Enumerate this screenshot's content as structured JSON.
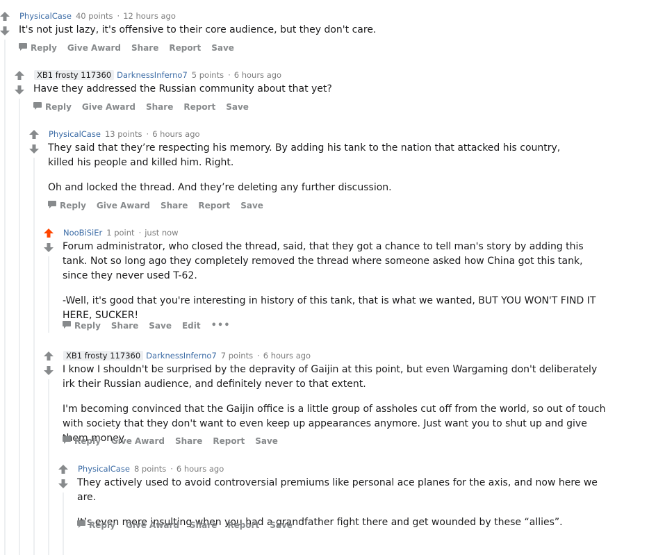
{
  "comments": [
    {
      "author": "PhysicalCase",
      "flair": "",
      "points": "40 points",
      "time": "12 hours ago",
      "upvoted": false,
      "paragraphs": [
        "It's not just lazy, it's offensive to their core audience, but they don't care."
      ],
      "actions": [
        "Reply",
        "Give Award",
        "Share",
        "Report",
        "Save"
      ]
    },
    {
      "author": "DarknessInferno7",
      "flair": "XB1 frosty 117360",
      "points": "5 points",
      "time": "6 hours ago",
      "upvoted": false,
      "paragraphs": [
        "Have they addressed the Russian community about that yet?"
      ],
      "actions": [
        "Reply",
        "Give Award",
        "Share",
        "Report",
        "Save"
      ]
    },
    {
      "author": "PhysicalCase",
      "flair": "",
      "points": "13 points",
      "time": "6 hours ago",
      "upvoted": false,
      "paragraphs": [
        "They said that they’re respecting his memory. By adding his tank to the nation that attacked his country, killed his people and killed him. Right.",
        "Oh and locked the thread. And they’re deleting any further discussion."
      ],
      "actions": [
        "Reply",
        "Give Award",
        "Share",
        "Report",
        "Save"
      ]
    },
    {
      "author": "NooBiSiEr",
      "flair": "",
      "points": "1 point",
      "time": "just now",
      "upvoted": true,
      "paragraphs": [
        "Forum administrator, who closed the thread, said, that they got a chance to tell man's story by adding this tank. Not so long ago they completely removed the thread where someone asked how China got this tank, since they never used T-62.",
        "-Well, it's good that you're interesting in history of this tank, that is what we wanted, BUT YOU WON'T FIND IT HERE, SUCKER!"
      ],
      "actions": [
        "Reply",
        "Share",
        "Save",
        "Edit",
        "•••"
      ]
    },
    {
      "author": "DarknessInferno7",
      "flair": "XB1 frosty 117360",
      "points": "7 points",
      "time": "6 hours ago",
      "upvoted": false,
      "paragraphs": [
        "I know I shouldn't be surprised by the depravity of Gaijin at this point, but even Wargaming don't deliberately irk their Russian audience, and definitely never to that extent.",
        "I'm becoming convinced that the Gaijin office is a little group of assholes cut off from the world, so out of touch with society that they don't want to even keep up appearances anymore. Just want you to shut up and give them money."
      ],
      "actions": [
        "Reply",
        "Give Award",
        "Share",
        "Report",
        "Save"
      ]
    },
    {
      "author": "PhysicalCase",
      "flair": "",
      "points": "8 points",
      "time": "6 hours ago",
      "upvoted": false,
      "paragraphs": [
        "They actively used to avoid controversial premiums like personal ace planes for the axis, and now here we are.",
        "It’s even more insulting when you had a grandfather fight there and get wounded by these “allies”."
      ],
      "actions": [
        "Reply",
        "Give Award",
        "Share",
        "Report",
        "Save"
      ]
    }
  ],
  "colors": {
    "upvote_active": "#ff4500",
    "vote_idle": "#878a8c",
    "author": "#3b6ba5",
    "thread_line": "#edeff1"
  }
}
